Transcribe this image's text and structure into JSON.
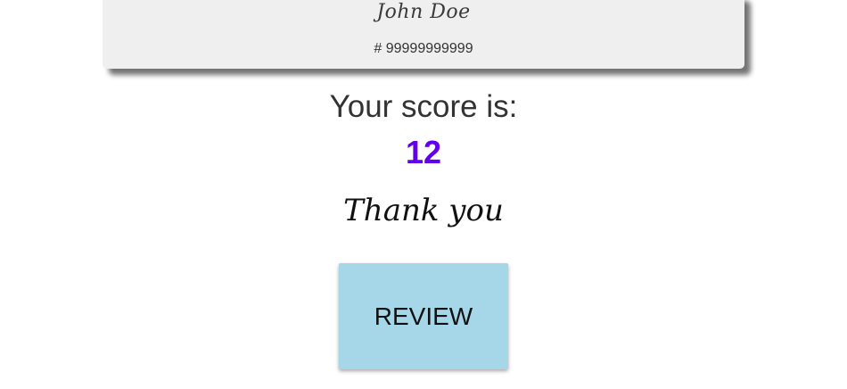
{
  "user": {
    "name": "John Doe",
    "id": "# 99999999999"
  },
  "result": {
    "label": "Your score is:",
    "score": "12",
    "thanks": "Thank you"
  },
  "actions": {
    "review_label": "REVIEW"
  },
  "colors": {
    "score": "#6200ee",
    "button": "#a6d7e8",
    "card": "#efefef"
  }
}
